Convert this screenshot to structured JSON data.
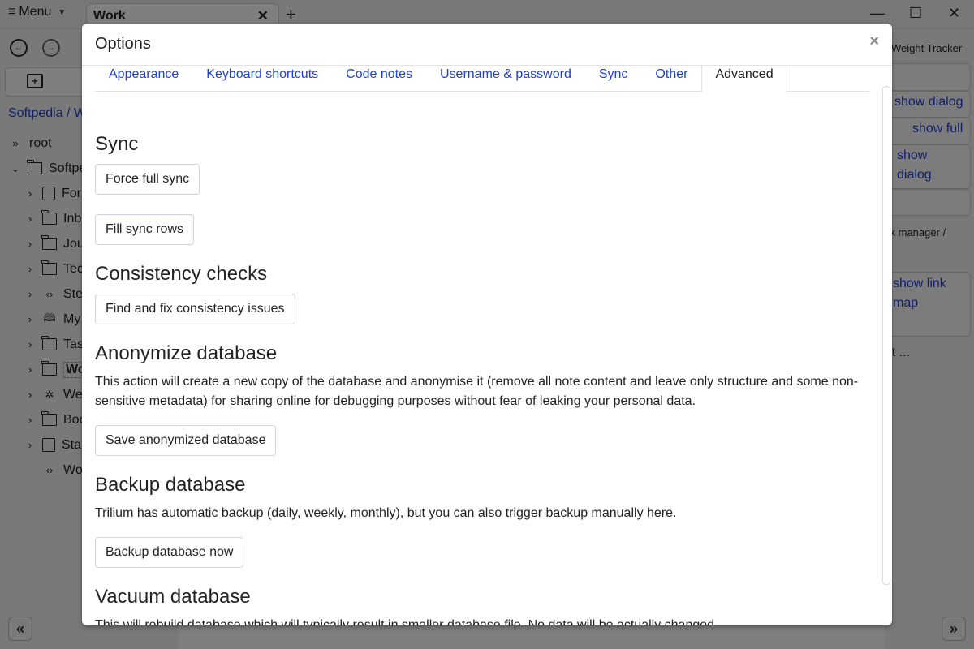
{
  "app": {
    "menu_label": "Menu",
    "active_tab": "Work",
    "breadcrumb": "Softpedia / W",
    "tree": [
      {
        "label": "root",
        "icon": "double-chevron-icon",
        "indent": 0
      },
      {
        "label": "Softpe",
        "icon": "folder-icon",
        "indent": 1,
        "expanded": true
      },
      {
        "label": "For",
        "icon": "book-icon",
        "indent": 2
      },
      {
        "label": "Inbo",
        "icon": "folder-icon",
        "indent": 2
      },
      {
        "label": "Jou",
        "icon": "folder-icon",
        "indent": 2
      },
      {
        "label": "Tec",
        "icon": "folder-icon",
        "indent": 2
      },
      {
        "label": "Ste",
        "icon": "code-icon",
        "indent": 2
      },
      {
        "label": "My",
        "icon": "map-icon",
        "indent": 2
      },
      {
        "label": "Tas",
        "icon": "folder-icon",
        "indent": 2
      },
      {
        "label": "Wo",
        "icon": "folder-icon",
        "indent": 2,
        "active": true
      },
      {
        "label": "Wei",
        "icon": "puzzle-icon",
        "indent": 2
      },
      {
        "label": "Boo",
        "icon": "folder-icon",
        "indent": 2
      },
      {
        "label": "Sta",
        "icon": "book-icon",
        "indent": 2
      },
      {
        "label": "Wo",
        "icon": "code-icon",
        "indent": 2,
        "leaf": true
      }
    ],
    "right_pane": {
      "title": "Weight Tracker",
      "links": [
        "show dialog",
        "show full",
        "show dialog",
        "show link map"
      ],
      "texts": [
        "sk manager /",
        "et ..."
      ]
    }
  },
  "dialog": {
    "title": "Options",
    "close_label": "×",
    "tabs": [
      {
        "label": "Appearance",
        "active": false
      },
      {
        "label": "Keyboard shortcuts",
        "active": false
      },
      {
        "label": "Code notes",
        "active": false
      },
      {
        "label": "Username & password",
        "active": false
      },
      {
        "label": "Sync",
        "active": false
      },
      {
        "label": "Other",
        "active": false
      },
      {
        "label": "Advanced",
        "active": true
      }
    ],
    "sections": {
      "sync": {
        "heading": "Sync",
        "buttons": [
          "Force full sync",
          "Fill sync rows"
        ]
      },
      "consistency": {
        "heading": "Consistency checks",
        "buttons": [
          "Find and fix consistency issues"
        ]
      },
      "anonymize": {
        "heading": "Anonymize database",
        "description": "This action will create a new copy of the database and anonymise it (remove all note content and leave only structure and some non-sensitive metadata) for sharing online for debugging purposes without fear of leaking your personal data.",
        "buttons": [
          "Save anonymized database"
        ]
      },
      "backup": {
        "heading": "Backup database",
        "description": "Trilium has automatic backup (daily, weekly, monthly), but you can also trigger backup manually here.",
        "buttons": [
          "Backup database now"
        ]
      },
      "vacuum": {
        "heading": "Vacuum database",
        "description": "This will rebuild database which will typically result in smaller database file. No data will be actually changed."
      }
    }
  }
}
